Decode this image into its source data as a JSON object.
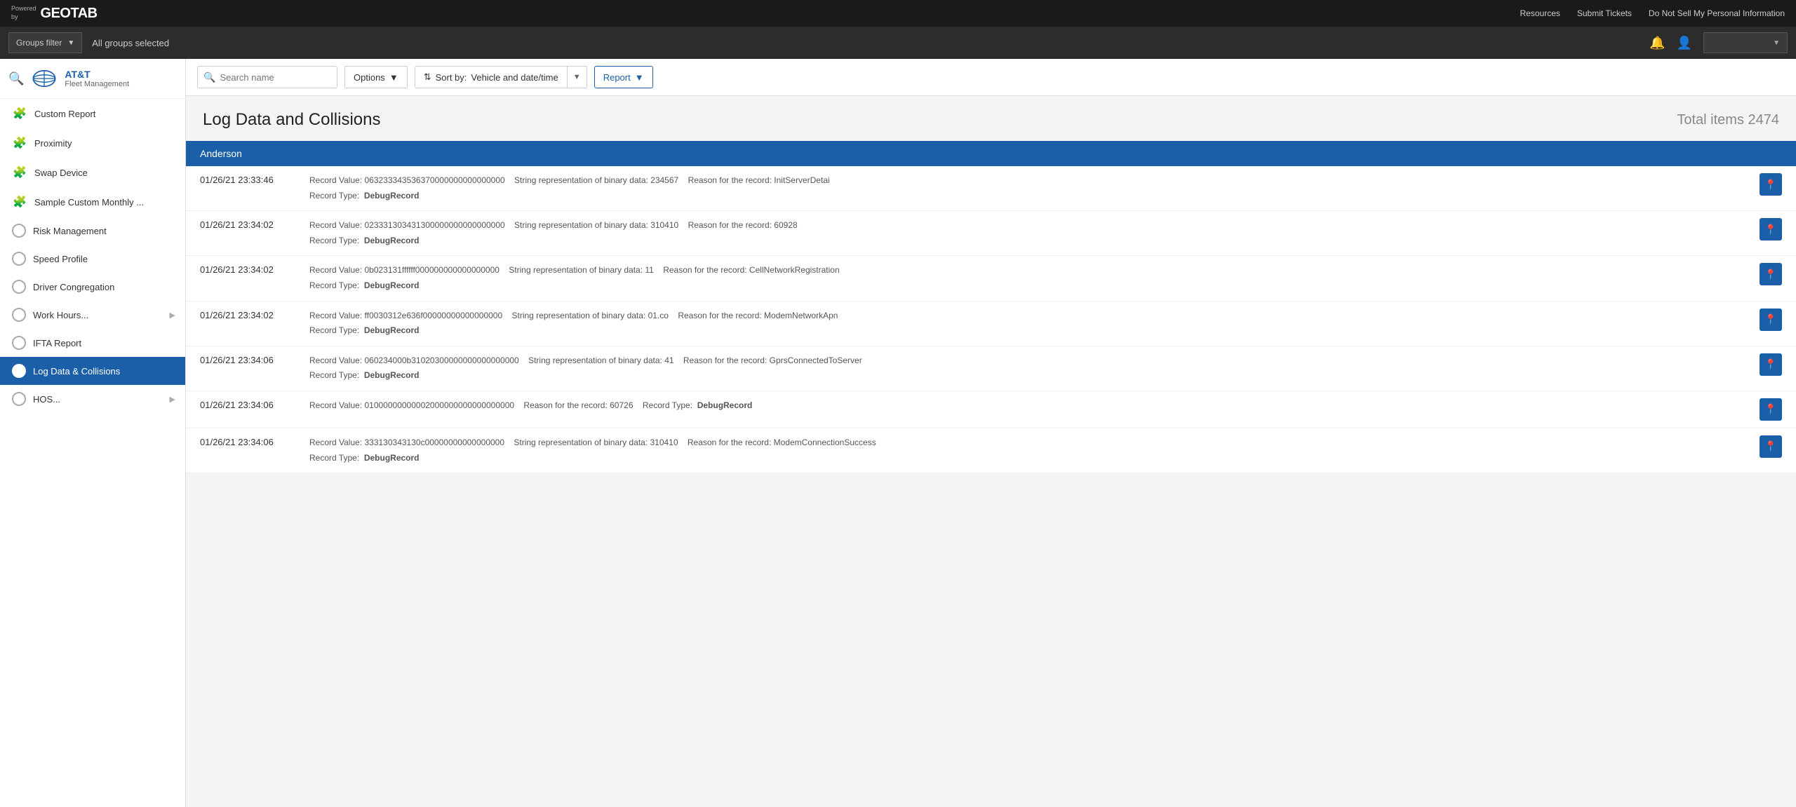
{
  "topbar": {
    "logo": {
      "powered_by": "Powered\nby",
      "name": "GEOTAB"
    },
    "nav_links": [
      {
        "label": "Resources"
      },
      {
        "label": "Submit Tickets"
      }
    ],
    "do_not_sell": "Do Not Sell My Personal Information"
  },
  "groups_bar": {
    "filter_label": "Groups filter",
    "all_groups_label": "All groups selected",
    "user_dropdown_placeholder": ""
  },
  "sidebar": {
    "company": {
      "logo_alt": "AT&T logo",
      "name": "AT&T",
      "subtitle": "Fleet Management"
    },
    "nav_items": [
      {
        "id": "custom-report",
        "label": "Custom Report",
        "icon": "puzzle",
        "has_arrow": false,
        "active": false
      },
      {
        "id": "proximity",
        "label": "Proximity",
        "icon": "puzzle-circle",
        "has_arrow": false,
        "active": false
      },
      {
        "id": "swap-device",
        "label": "Swap Device",
        "icon": "puzzle",
        "has_arrow": false,
        "active": false
      },
      {
        "id": "sample-custom-monthly",
        "label": "Sample Custom Monthly ...",
        "icon": "puzzle",
        "has_arrow": false,
        "active": false
      },
      {
        "id": "risk-management",
        "label": "Risk Management",
        "icon": "circle-outline",
        "has_arrow": false,
        "active": false
      },
      {
        "id": "speed-profile",
        "label": "Speed Profile",
        "icon": "circle-outline",
        "has_arrow": false,
        "active": false
      },
      {
        "id": "driver-congregation",
        "label": "Driver Congregation",
        "icon": "circle-outline",
        "has_arrow": false,
        "active": false
      },
      {
        "id": "work-hours",
        "label": "Work Hours...",
        "icon": "circle-outline",
        "has_arrow": true,
        "active": false
      },
      {
        "id": "ifta-report",
        "label": "IFTA Report",
        "icon": "circle-outline",
        "has_arrow": false,
        "active": false
      },
      {
        "id": "log-data-collisions",
        "label": "Log Data & Collisions",
        "icon": "circle-filled",
        "has_arrow": false,
        "active": true
      },
      {
        "id": "hos",
        "label": "HOS...",
        "icon": "circle-outline",
        "has_arrow": true,
        "active": false
      }
    ]
  },
  "toolbar": {
    "search_placeholder": "Search name",
    "options_label": "Options",
    "sort_label": "Sort by:",
    "sort_value": "Vehicle and date/time",
    "report_label": "Report"
  },
  "content": {
    "page_title": "Log Data and Collisions",
    "total_label": "Total items 2474",
    "group_header": "Anderson",
    "rows": [
      {
        "date": "01/26/21 23:33:46",
        "record_value": "Record Value: 063233343536370000000000000000",
        "binary_data": "String representation of binary data: 234567",
        "reason": "Reason for the record: InitServerDetai",
        "record_type_label": "Record Type:",
        "record_type_val": "DebugRecord"
      },
      {
        "date": "01/26/21 23:34:02",
        "record_value": "Record Value: 023331303431300000000000000000",
        "binary_data": "String representation of binary data: 310410",
        "reason": "Reason for the record: 60928",
        "record_type_label": "Record Type:",
        "record_type_val": "DebugRecord"
      },
      {
        "date": "01/26/21 23:34:02",
        "record_value": "Record Value: 0b023131ffffff000000000000000000",
        "binary_data": "String representation of binary data: 11",
        "reason": "Reason for the record: CellNetworkRegistration",
        "record_type_label": "Record Type:",
        "record_type_val": "DebugRecord"
      },
      {
        "date": "01/26/21 23:34:02",
        "record_value": "Record Value: ff0030312e636f00000000000000000",
        "binary_data": "String representation of binary data: 01.co",
        "reason": "Reason for the record: ModemNetworkApn",
        "record_type_label": "Record Type:",
        "record_type_val": "DebugRecord"
      },
      {
        "date": "01/26/21 23:34:06",
        "record_value": "Record Value: 060234000b31020300000000000000000",
        "binary_data": "String representation of binary data: 41",
        "reason": "Reason for the record: GprsConnectedToServer",
        "record_type_label": "Record Type:",
        "record_type_val": "DebugRecord"
      },
      {
        "date": "01/26/21 23:34:06",
        "record_value": "Record Value: 01000000000002000000000000000000",
        "binary_data": null,
        "reason": "Reason for the record: 60726",
        "record_type_label": "Record Type:",
        "record_type_val": "DebugRecord",
        "extra_label": "Record Type:",
        "extra_val": "DebugRecord"
      },
      {
        "date": "01/26/21 23:34:06",
        "record_value": "Record Value: 333130343130c00000000000000000",
        "binary_data": "String representation of binary data: 310410",
        "reason": "Reason for the record: ModemConnectionSuccess",
        "record_type_label": "Record Type:",
        "record_type_val": "DebugRecord"
      }
    ],
    "action_icon": "📍"
  }
}
